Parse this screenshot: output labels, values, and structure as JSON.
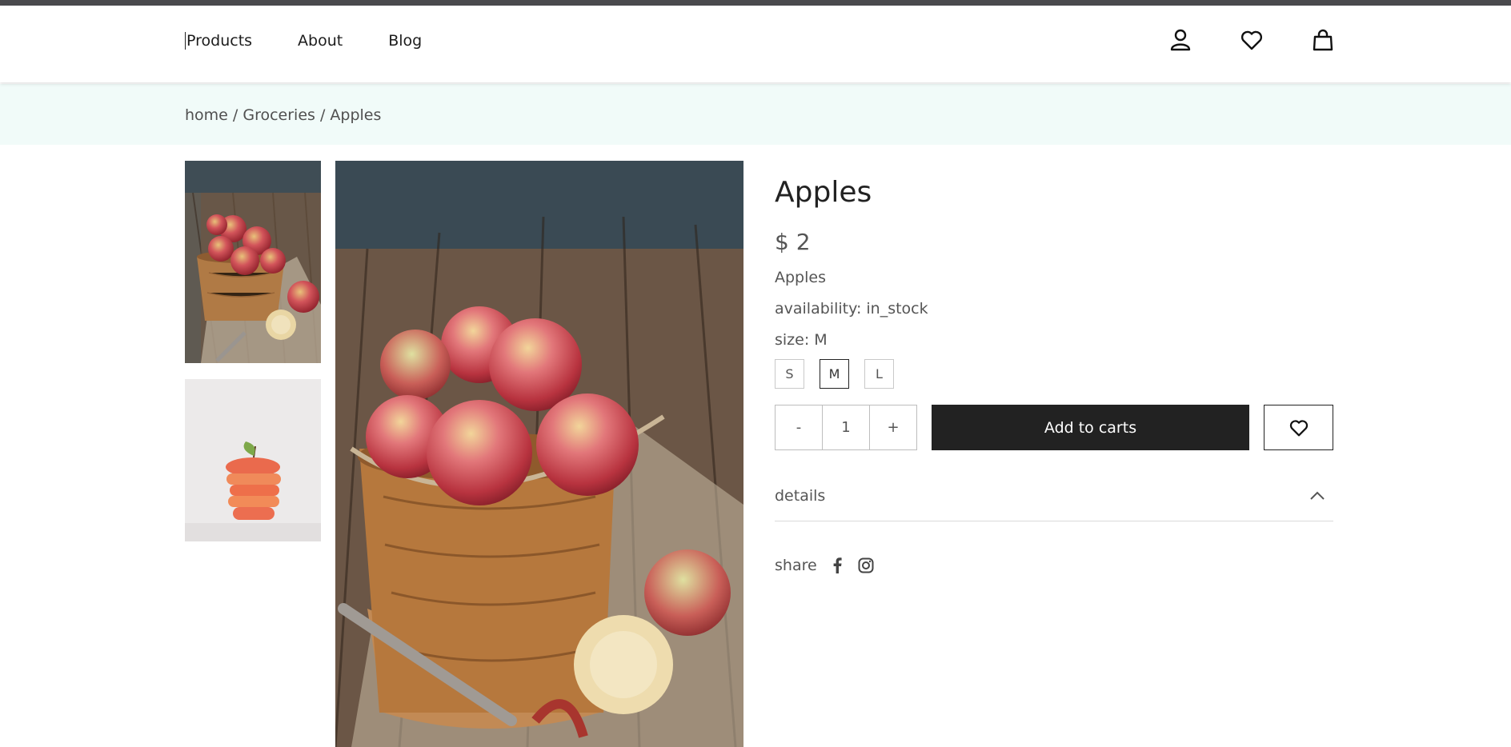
{
  "nav": {
    "links": [
      "Products",
      "About",
      "Blog"
    ],
    "icons": [
      "user-icon",
      "heart-icon",
      "shopping-bag-icon"
    ]
  },
  "breadcrumb": {
    "items": [
      "home",
      "Groceries",
      "Apples"
    ],
    "separator": " / "
  },
  "product": {
    "title": "Apples",
    "price": "$ 2",
    "description": "Apples",
    "availability": "availability: in_stock",
    "size_label": "size: M",
    "sizes": [
      "S",
      "M",
      "L"
    ],
    "selected_size": "M",
    "quantity": {
      "decrement": "-",
      "value": "1",
      "increment": "+"
    },
    "add_to_cart": "Add to carts",
    "details_label": "details",
    "share_label": "share",
    "share_icons": [
      "facebook-icon",
      "instagram-icon"
    ]
  },
  "gallery": {
    "thumbnails": [
      "apples-in-wooden-bucket-thumbnail",
      "sliced-apple-thumbnail"
    ],
    "main_image": "apples-in-wooden-bucket"
  },
  "colors": {
    "top_strip": "#4a4a4d",
    "breadcrumb_bg": "#f1fbf9",
    "primary_button": "#222222",
    "text": "#555555"
  }
}
